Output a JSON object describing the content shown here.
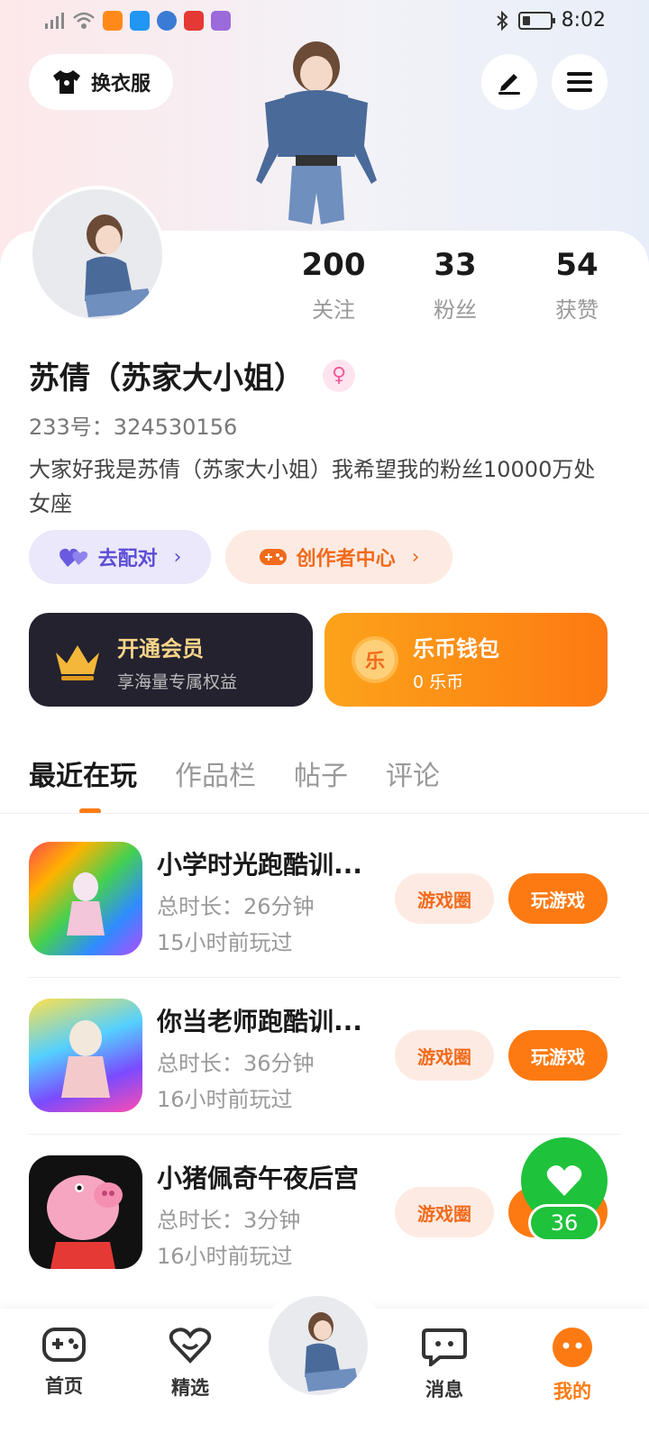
{
  "status_bar": {
    "time": "8:02"
  },
  "header": {
    "dress_up_label": "换衣服"
  },
  "profile": {
    "name": "苏倩（苏家大小姐）",
    "gender_symbol": "♀",
    "id_label": "233号：324530156",
    "bio": "大家好我是苏倩（苏家大小姐）我希望我的粉丝10000万处女座",
    "stats": [
      {
        "value": "200",
        "label": "关注"
      },
      {
        "value": "33",
        "label": "粉丝"
      },
      {
        "value": "54",
        "label": "获赞"
      }
    ],
    "match_label": "去配对",
    "creator_label": "创作者中心"
  },
  "vip": {
    "title": "开通会员",
    "subtitle": "享海量专属权益"
  },
  "wallet": {
    "title": "乐币钱包",
    "subtitle": "0 乐币",
    "coin_char": "乐"
  },
  "tabs": [
    "最近在玩",
    "作品栏",
    "帖子",
    "评论"
  ],
  "games": [
    {
      "title": "小学时光跑酷训...",
      "duration": "总时长：26分钟",
      "last_played": "15小时前玩过",
      "circle_label": "游戏圈",
      "play_label": "玩游戏"
    },
    {
      "title": "你当老师跑酷训...",
      "duration": "总时长：36分钟",
      "last_played": "16小时前玩过",
      "circle_label": "游戏圈",
      "play_label": "玩游戏"
    },
    {
      "title": "小猪佩奇午夜后宫",
      "duration": "总时长：3分钟",
      "last_played": "16小时前玩过",
      "circle_label": "游戏圈",
      "play_label": "玩游戏"
    }
  ],
  "like_fab": {
    "count": "36"
  },
  "bottom_nav": [
    {
      "label": "首页",
      "icon": "gamepad-icon"
    },
    {
      "label": "精选",
      "icon": "heart-outline-icon"
    },
    {
      "label": "消息",
      "icon": "chat-icon"
    },
    {
      "label": "我的",
      "icon": "smile-face-icon"
    }
  ],
  "colors": {
    "accent": "#fd7a12",
    "match": "#5b4ed6",
    "like": "#1fc23b"
  }
}
